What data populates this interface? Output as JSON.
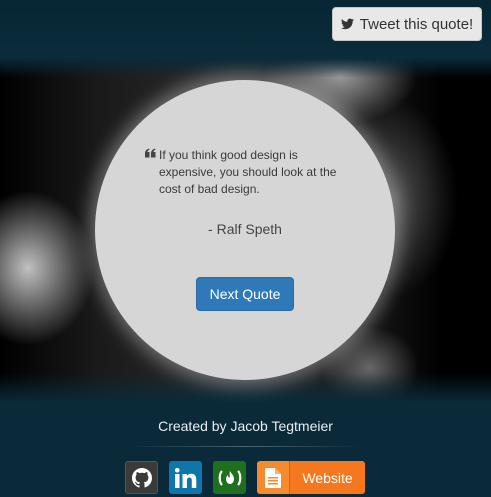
{
  "header": {
    "tweet_label": "Tweet this quote!",
    "tweet_icon": "twitter-bird-icon"
  },
  "quote": {
    "text": "If you think good design is expensive, you should look at the cost of bad design.",
    "author": "- Ralf Speth",
    "quote_icon": "quote-left-icon"
  },
  "actions": {
    "next_label": "Next Quote"
  },
  "footer": {
    "credit": "Created by Jacob Tegtmeier",
    "links": [
      {
        "name": "github",
        "icon": "github-icon"
      },
      {
        "name": "linkedin",
        "icon": "linkedin-icon"
      },
      {
        "name": "freecodecamp",
        "icon": "freecodecamp-icon"
      }
    ],
    "website_label": "Website",
    "website_icon": "document-icon"
  },
  "colors": {
    "background": "#0a2a39",
    "primary_button": "#3079b8",
    "website_orange": "#f5781e",
    "linkedin_blue": "#0e76a8",
    "fcc_green": "#1e6f1e",
    "github_gray": "#3a3a3a",
    "circle_gray": "#d6d6d6"
  }
}
